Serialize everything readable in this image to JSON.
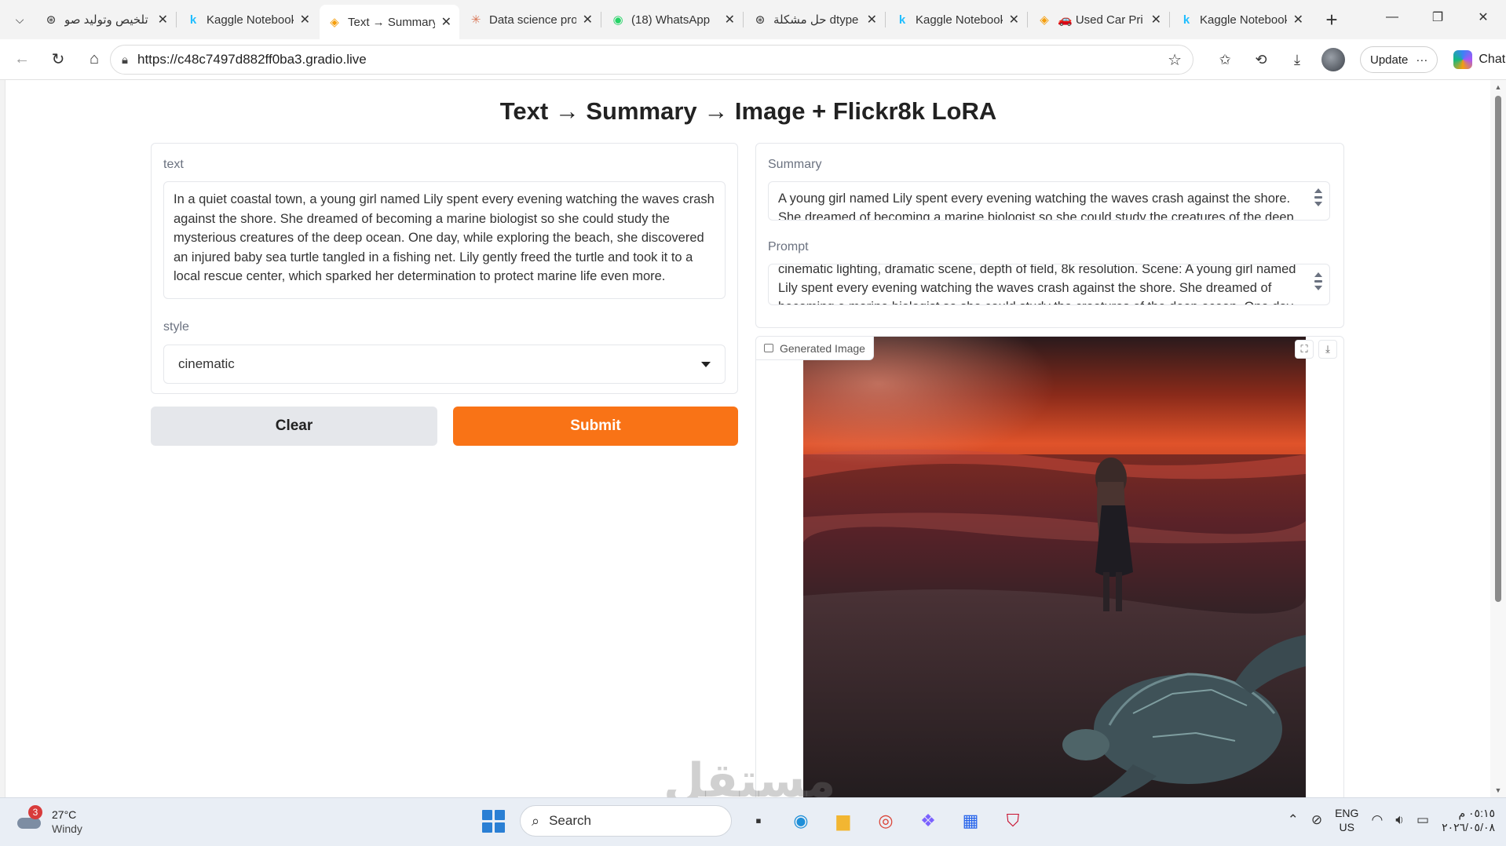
{
  "browser": {
    "tabs": [
      {
        "title": "تلخيص وتوليد صو",
        "icon": "openai-icon",
        "glyph": "⊛",
        "color": "#333333",
        "active": false
      },
      {
        "title": "Kaggle Notebook",
        "icon": "kaggle-icon",
        "glyph": "k",
        "color": "#20beff",
        "active": false
      },
      {
        "title": "Text → Summary",
        "icon": "gradio-icon",
        "glyph": "◈",
        "color": "#f59e0b",
        "active": true
      },
      {
        "title": "Data science pro",
        "icon": "claude-icon",
        "glyph": "✳",
        "color": "#d97757",
        "active": false
      },
      {
        "title": "(18) WhatsApp",
        "icon": "whatsapp-icon",
        "glyph": "◉",
        "color": "#25d366",
        "active": false
      },
      {
        "title": "حل مشكلة dtype",
        "icon": "openai-icon",
        "glyph": "⊛",
        "color": "#333333",
        "active": false
      },
      {
        "title": "Kaggle Notebook",
        "icon": "kaggle-icon",
        "glyph": "k",
        "color": "#20beff",
        "active": false
      },
      {
        "title": "🚗 Used Car Pri",
        "icon": "gradio-icon",
        "glyph": "◈",
        "color": "#f59e0b",
        "active": false
      },
      {
        "title": "Kaggle Notebook",
        "icon": "kaggle-icon",
        "glyph": "k",
        "color": "#20beff",
        "active": false
      }
    ],
    "url": "https://c48c7497d882ff0ba3.gradio.live",
    "update_label": "Update",
    "chat_label": "Chat"
  },
  "app": {
    "title": "Text → Summary → Image + Flickr8k LoRA",
    "input": {
      "text_label": "text",
      "text_value": "In a quiet coastal town, a young girl named Lily spent every evening watching the waves crash against the shore. She dreamed of becoming a marine biologist so she could study the mysterious creatures of the deep ocean. One day, while exploring the beach, she discovered an injured baby sea turtle tangled in a fishing net. Lily gently freed the turtle and took it to a local rescue center, which sparked her determination to protect marine life even more.",
      "style_label": "style",
      "style_value": "cinematic"
    },
    "buttons": {
      "clear": "Clear",
      "submit": "Submit"
    },
    "output": {
      "summary_label": "Summary",
      "summary_value": "A young girl named Lily spent every evening watching the waves crash against the shore. She dreamed of becoming a marine biologist so she could study the creatures of the deep",
      "prompt_label": "Prompt",
      "prompt_value": "cinematic lighting, dramatic scene, depth of field, 8k resolution. Scene: A young girl named Lily spent every evening watching the waves crash against the shore. She dreamed of becoming a marine biologist so she could study the creatures of the deep ocean. One day",
      "image_label": "Generated Image"
    },
    "colors": {
      "accent": "#f97316",
      "secondary_button": "#e5e7eb"
    }
  },
  "taskbar": {
    "weather_temp": "27°C",
    "weather_cond": "Windy",
    "weather_badge": "3",
    "search_label": "Search",
    "lang_line1": "ENG",
    "lang_line2": "US",
    "time": "٠٥:١٥ م",
    "date": "٢٠٢٦/٠٥/٠٨"
  },
  "watermark": "مستقل"
}
